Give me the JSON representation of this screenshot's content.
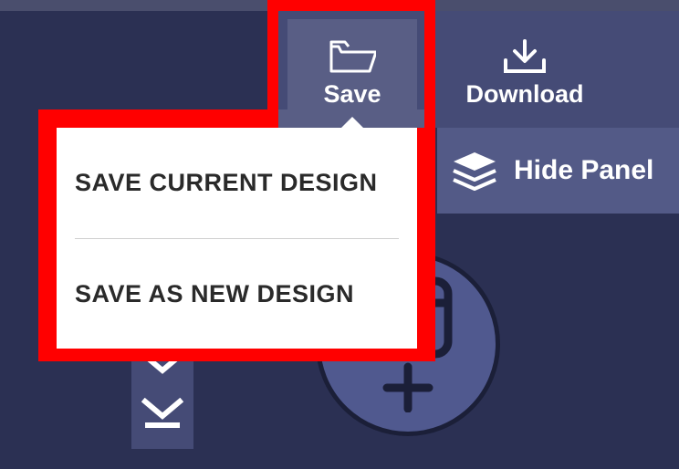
{
  "toolbar": {
    "save_label": "Save",
    "download_label": "Download"
  },
  "subbar": {
    "hide_panel_label": "Hide Panel"
  },
  "menu": {
    "items": [
      {
        "label": "SAVE CURRENT DESIGN"
      },
      {
        "label": "SAVE AS NEW DESIGN"
      }
    ]
  }
}
